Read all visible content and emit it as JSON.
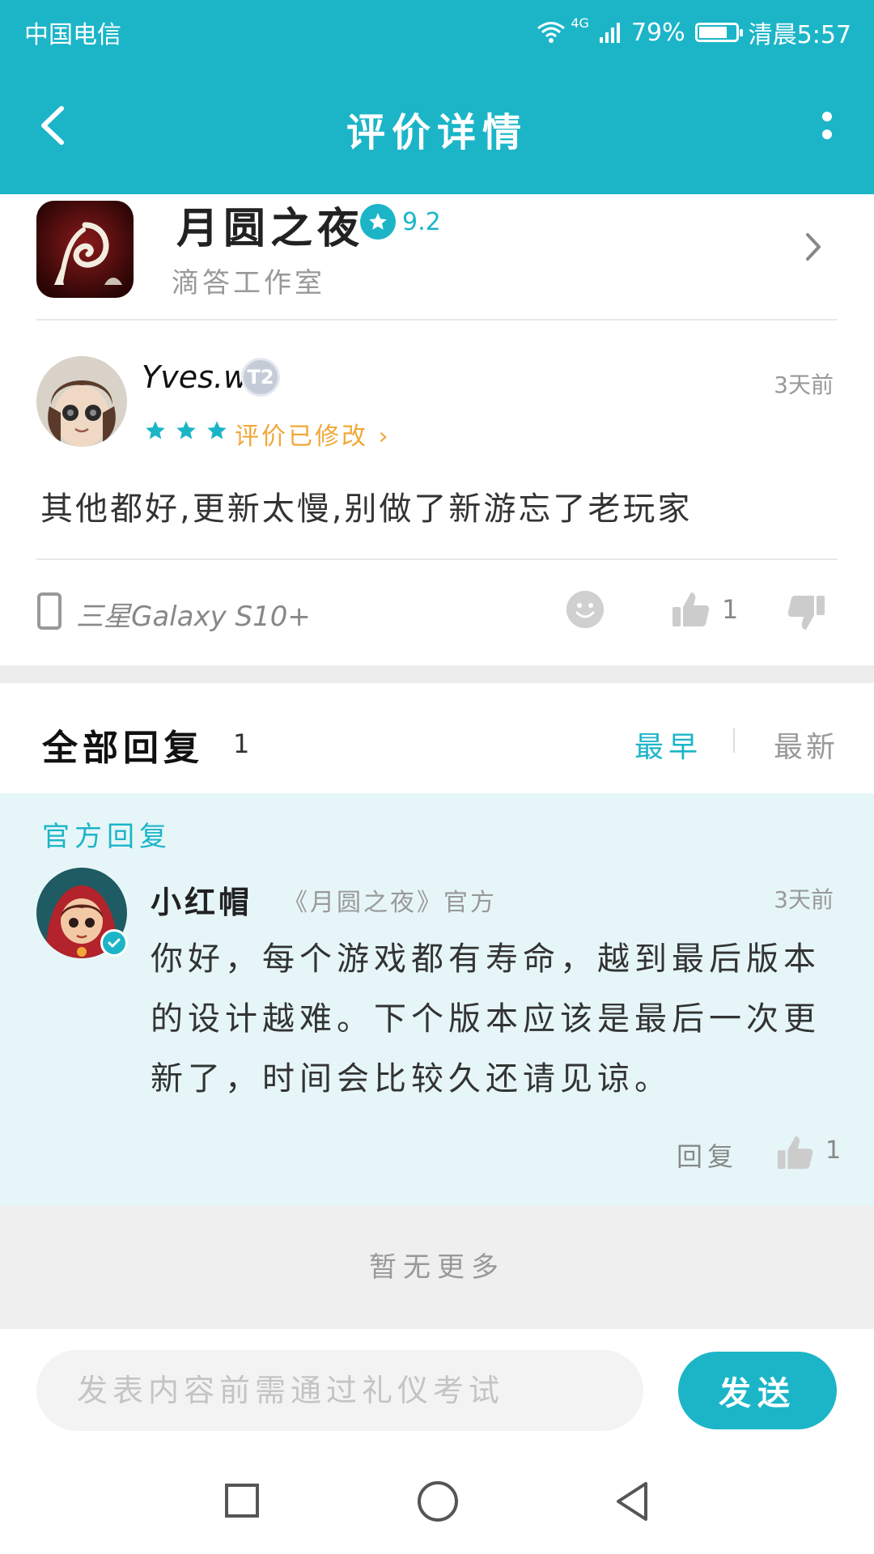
{
  "status_bar": {
    "carrier": "中国电信",
    "network": "4G",
    "battery": "79%",
    "battery_level": 0.79,
    "time": "清晨5:57"
  },
  "header": {
    "title": "评价详情",
    "back_icon": "chevron-left-icon",
    "more_icon": "more-vertical-icon"
  },
  "game": {
    "name": "月圆之夜",
    "rating": "9.2",
    "studio": "滴答工作室",
    "icon": "moon-night-game-icon"
  },
  "review": {
    "user": "Yves.w",
    "level_badge": "T2",
    "time": "3天前",
    "stars": 3,
    "edited_label": "评价已修改 ›",
    "text": "其他都好,更新太慢,别做了新游忘了老玩家",
    "device": "三星Galaxy S10+",
    "likes": "1"
  },
  "replies": {
    "title": "全部回复",
    "count": "1",
    "sort_earliest": "最早",
    "sort_latest": "最新"
  },
  "official_reply": {
    "label": "官方回复",
    "author": "小红帽",
    "tag": "《月圆之夜》官方",
    "time": "3天前",
    "text": "你好，每个游戏都有寿命，越到最后版本的设计越难。下个版本应该是最后一次更新了，时间会比较久还请见谅。",
    "reply_label": "回复",
    "likes": "1"
  },
  "no_more": "暂无更多",
  "composer": {
    "placeholder": "发表内容前需通过礼仪考试",
    "send_label": "发送"
  },
  "colors": {
    "accent": "#1cb5c8",
    "star": "#1cb5c8",
    "edited": "#f0a838",
    "official_bg": "#e6f6f8"
  }
}
